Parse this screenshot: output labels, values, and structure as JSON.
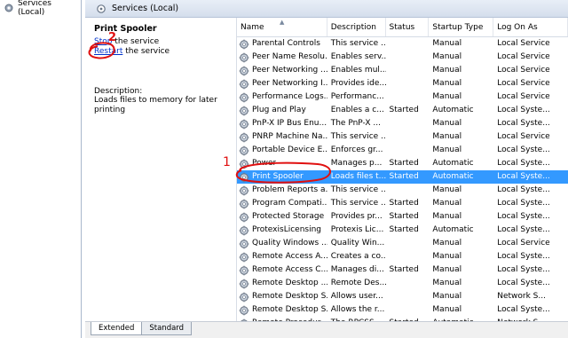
{
  "tree": {
    "root_label": "Services (Local)"
  },
  "header": {
    "title": "Services (Local)"
  },
  "details": {
    "service_name": "Print Spooler",
    "stop_link": "Stop",
    "stop_suffix": " the service",
    "restart_link": "Restart",
    "restart_suffix": " the service",
    "description_label": "Description:",
    "description_text": "Loads files to memory for later printing"
  },
  "columns": [
    "Name",
    "Description",
    "Status",
    "Startup Type",
    "Log On As"
  ],
  "services": [
    {
      "name": "Parental Controls",
      "description": "This service ...",
      "status": "",
      "startup": "Manual",
      "logon": "Local Service"
    },
    {
      "name": "Peer Name Resolu...",
      "description": "Enables serv...",
      "status": "",
      "startup": "Manual",
      "logon": "Local Service"
    },
    {
      "name": "Peer Networking ...",
      "description": "Enables mul...",
      "status": "",
      "startup": "Manual",
      "logon": "Local Service"
    },
    {
      "name": "Peer Networking I...",
      "description": "Provides ide...",
      "status": "",
      "startup": "Manual",
      "logon": "Local Service"
    },
    {
      "name": "Performance Logs...",
      "description": "Performanc...",
      "status": "",
      "startup": "Manual",
      "logon": "Local Service"
    },
    {
      "name": "Plug and Play",
      "description": "Enables a c...",
      "status": "Started",
      "startup": "Automatic",
      "logon": "Local Syste..."
    },
    {
      "name": "PnP-X IP Bus Enu...",
      "description": "The PnP-X ...",
      "status": "",
      "startup": "Manual",
      "logon": "Local Syste..."
    },
    {
      "name": "PNRP Machine Na...",
      "description": "This service ...",
      "status": "",
      "startup": "Manual",
      "logon": "Local Service"
    },
    {
      "name": "Portable Device E...",
      "description": "Enforces gr...",
      "status": "",
      "startup": "Manual",
      "logon": "Local Syste..."
    },
    {
      "name": "Power",
      "description": "Manages p...",
      "status": "Started",
      "startup": "Automatic",
      "logon": "Local Syste..."
    },
    {
      "name": "Print Spooler",
      "description": "Loads files t...",
      "status": "Started",
      "startup": "Automatic",
      "logon": "Local Syste...",
      "selected": true
    },
    {
      "name": "Problem Reports a...",
      "description": "This service ...",
      "status": "",
      "startup": "Manual",
      "logon": "Local Syste..."
    },
    {
      "name": "Program Compati...",
      "description": "This service ...",
      "status": "Started",
      "startup": "Manual",
      "logon": "Local Syste..."
    },
    {
      "name": "Protected Storage",
      "description": "Provides pr...",
      "status": "Started",
      "startup": "Manual",
      "logon": "Local Syste..."
    },
    {
      "name": "ProtexisLicensing",
      "description": "Protexis Lic...",
      "status": "Started",
      "startup": "Automatic",
      "logon": "Local Syste..."
    },
    {
      "name": "Quality Windows ...",
      "description": "Quality Win...",
      "status": "",
      "startup": "Manual",
      "logon": "Local Service"
    },
    {
      "name": "Remote Access A...",
      "description": "Creates a co...",
      "status": "",
      "startup": "Manual",
      "logon": "Local Syste..."
    },
    {
      "name": "Remote Access C...",
      "description": "Manages di...",
      "status": "Started",
      "startup": "Manual",
      "logon": "Local Syste..."
    },
    {
      "name": "Remote Desktop ...",
      "description": "Remote Des...",
      "status": "",
      "startup": "Manual",
      "logon": "Local Syste..."
    },
    {
      "name": "Remote Desktop S...",
      "description": "Allows user...",
      "status": "",
      "startup": "Manual",
      "logon": "Network S..."
    },
    {
      "name": "Remote Desktop S...",
      "description": "Allows the r...",
      "status": "",
      "startup": "Manual",
      "logon": "Local Syste..."
    },
    {
      "name": "Remote Procedur...",
      "description": "The RPCSS ...",
      "status": "Started",
      "startup": "Automatic",
      "logon": "Network S..."
    }
  ],
  "tabs": [
    {
      "label": "Extended",
      "active": true
    },
    {
      "label": "Standard",
      "active": false
    }
  ],
  "annotations": {
    "marker_1": "1",
    "marker_2": "2",
    "color": "#e01010"
  },
  "colors": {
    "selection": "#3399ff",
    "link": "#0033cc"
  },
  "icons": {
    "service": "gear-icon",
    "tree_root": "services-icon",
    "header": "services-icon"
  }
}
